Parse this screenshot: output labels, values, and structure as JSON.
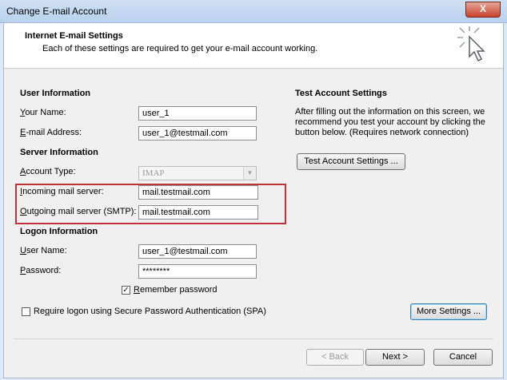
{
  "window": {
    "title": "Change E-mail Account",
    "close_glyph": "X"
  },
  "header": {
    "title": "Internet E-mail Settings",
    "subtitle": "Each of these settings are required to get your e-mail account working."
  },
  "user_info": {
    "section": "User Information",
    "your_name_label": "Your Name:",
    "your_name_value": "user_1",
    "email_label": "E-mail Address:",
    "email_value": "user_1@testmail.com"
  },
  "server_info": {
    "section": "Server Information",
    "account_type_label": "Account Type:",
    "account_type_value": "IMAP",
    "incoming_label": "Incoming mail server:",
    "incoming_value": "mail.testmail.com",
    "outgoing_label": "Outgoing mail server (SMTP):",
    "outgoing_value": "mail.testmail.com"
  },
  "logon_info": {
    "section": "Logon Information",
    "user_name_label": "User Name:",
    "user_name_value": "user_1@testmail.com",
    "password_label": "Password:",
    "password_value": "********",
    "remember_label": "Remember password",
    "remember_checked": true,
    "spa_label": "Require logon using Secure Password Authentication (SPA)",
    "spa_checked": false
  },
  "test_settings": {
    "section": "Test Account Settings",
    "description": "After filling out the information on this screen, we recommend you test your account by clicking the button below. (Requires network connection)",
    "button_label": "Test Account Settings ..."
  },
  "buttons": {
    "more_settings": "More Settings ...",
    "back": "< Back",
    "next": "Next >",
    "cancel": "Cancel"
  },
  "colors": {
    "highlight": "#c0323a"
  }
}
